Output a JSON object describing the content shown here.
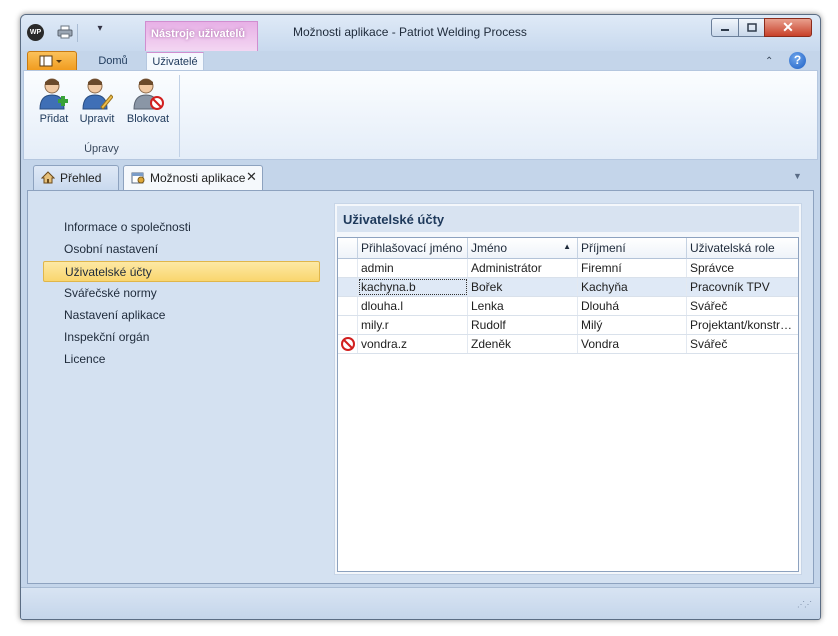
{
  "window": {
    "title": "Možnosti aplikace - Patriot Welding Process",
    "app_icon_text": "WP",
    "context_tab_header": "Nástroje uživatelů"
  },
  "ribbon": {
    "tabs": [
      {
        "label": "Domů"
      },
      {
        "label": "Uživatelé"
      }
    ],
    "buttons": [
      {
        "label": "Přidat",
        "icon": "user-add-icon"
      },
      {
        "label": "Upravit",
        "icon": "user-edit-icon"
      },
      {
        "label": "Blokovat",
        "icon": "user-block-icon"
      }
    ],
    "group_label": "Úpravy"
  },
  "doc_tabs": [
    {
      "label": "Přehled",
      "icon": "home-icon"
    },
    {
      "label": "Možnosti aplikace",
      "icon": "settings-icon"
    }
  ],
  "nav": {
    "items": [
      {
        "label": "Informace o společnosti"
      },
      {
        "label": "Osobní nastavení"
      },
      {
        "label": "Uživatelské účty"
      },
      {
        "label": "Svářečské normy"
      },
      {
        "label": "Nastavení aplikace"
      },
      {
        "label": "Inspekční orgán"
      },
      {
        "label": "Licence"
      }
    ],
    "selected_index": 2
  },
  "panel": {
    "title": "Uživatelské účty",
    "columns": [
      "Přihlašovací jméno",
      "Jméno",
      "Příjmení",
      "Uživatelská role"
    ],
    "sort_column": "Jméno",
    "rows": [
      {
        "login": "admin",
        "first": "Administrátor",
        "last": "Firemní",
        "role": "Správce",
        "blocked": false
      },
      {
        "login": "kachyna.b",
        "first": "Bořek",
        "last": "Kachyňa",
        "role": "Pracovník TPV",
        "blocked": false
      },
      {
        "login": "dlouha.l",
        "first": "Lenka",
        "last": "Dlouhá",
        "role": "Svářeč",
        "blocked": false
      },
      {
        "login": "mily.r",
        "first": "Rudolf",
        "last": "Milý",
        "role": "Projektant/konstr…",
        "blocked": false
      },
      {
        "login": "vondra.z",
        "first": "Zdeněk",
        "last": "Vondra",
        "role": "Svářeč",
        "blocked": true
      }
    ]
  },
  "colors": {
    "accent_orange": "#f09a1c",
    "context_pink": "#e7b0e6",
    "selection_yellow": "#f9d66e",
    "frame_blue": "#c4d5ea"
  }
}
